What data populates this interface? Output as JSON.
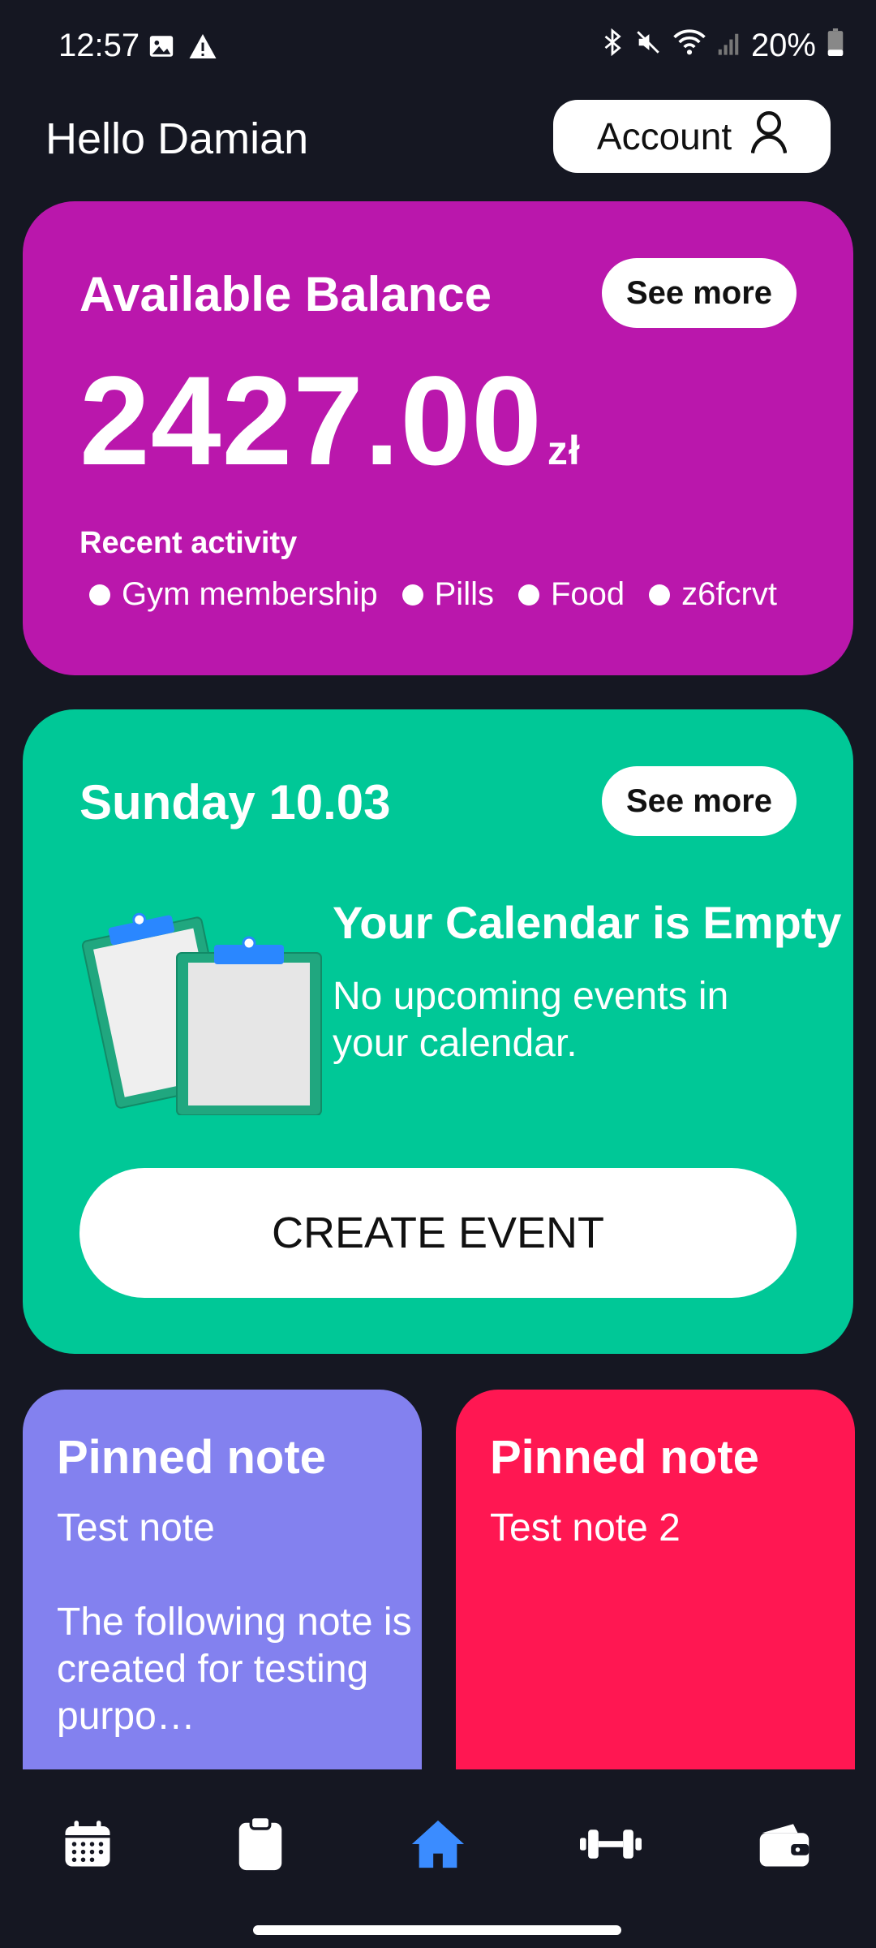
{
  "status_bar": {
    "time": "12:57",
    "battery": "20%",
    "icons": [
      "image-icon",
      "warning-icon",
      "bluetooth-icon",
      "mute-icon",
      "wifi-icon",
      "signal-icon",
      "battery-icon"
    ]
  },
  "header": {
    "greeting": "Hello Damian",
    "account_label": "Account",
    "account_icon": "user-icon"
  },
  "balance_card": {
    "title": "Available Balance",
    "see_more": "See more",
    "amount": "2427.00",
    "currency": "zł",
    "recent_label": "Recent activity",
    "recent_items": [
      "Gym membership",
      "Pills",
      "Food",
      "z6fcrvt"
    ],
    "color": "#ba17ac"
  },
  "calendar_card": {
    "date": "Sunday 10.03",
    "see_more": "See more",
    "empty_title": "Your Calendar is Empty",
    "empty_subtitle": "No upcoming events in your calendar.",
    "create_label": "CREATE EVENT",
    "color": "#00c897"
  },
  "notes": [
    {
      "title": "Pinned note",
      "body": "Test note\n\nThe following note is created for testing purpo…",
      "color": "#8381ef"
    },
    {
      "title": "Pinned note",
      "body": "Test note 2",
      "color": "#ff1752"
    }
  ],
  "bottom_nav": {
    "items": [
      "calendar-icon",
      "clipboard-icon",
      "home-icon",
      "dumbbell-icon",
      "wallet-icon"
    ],
    "active": "home-icon",
    "active_color": "#3b8cff"
  }
}
